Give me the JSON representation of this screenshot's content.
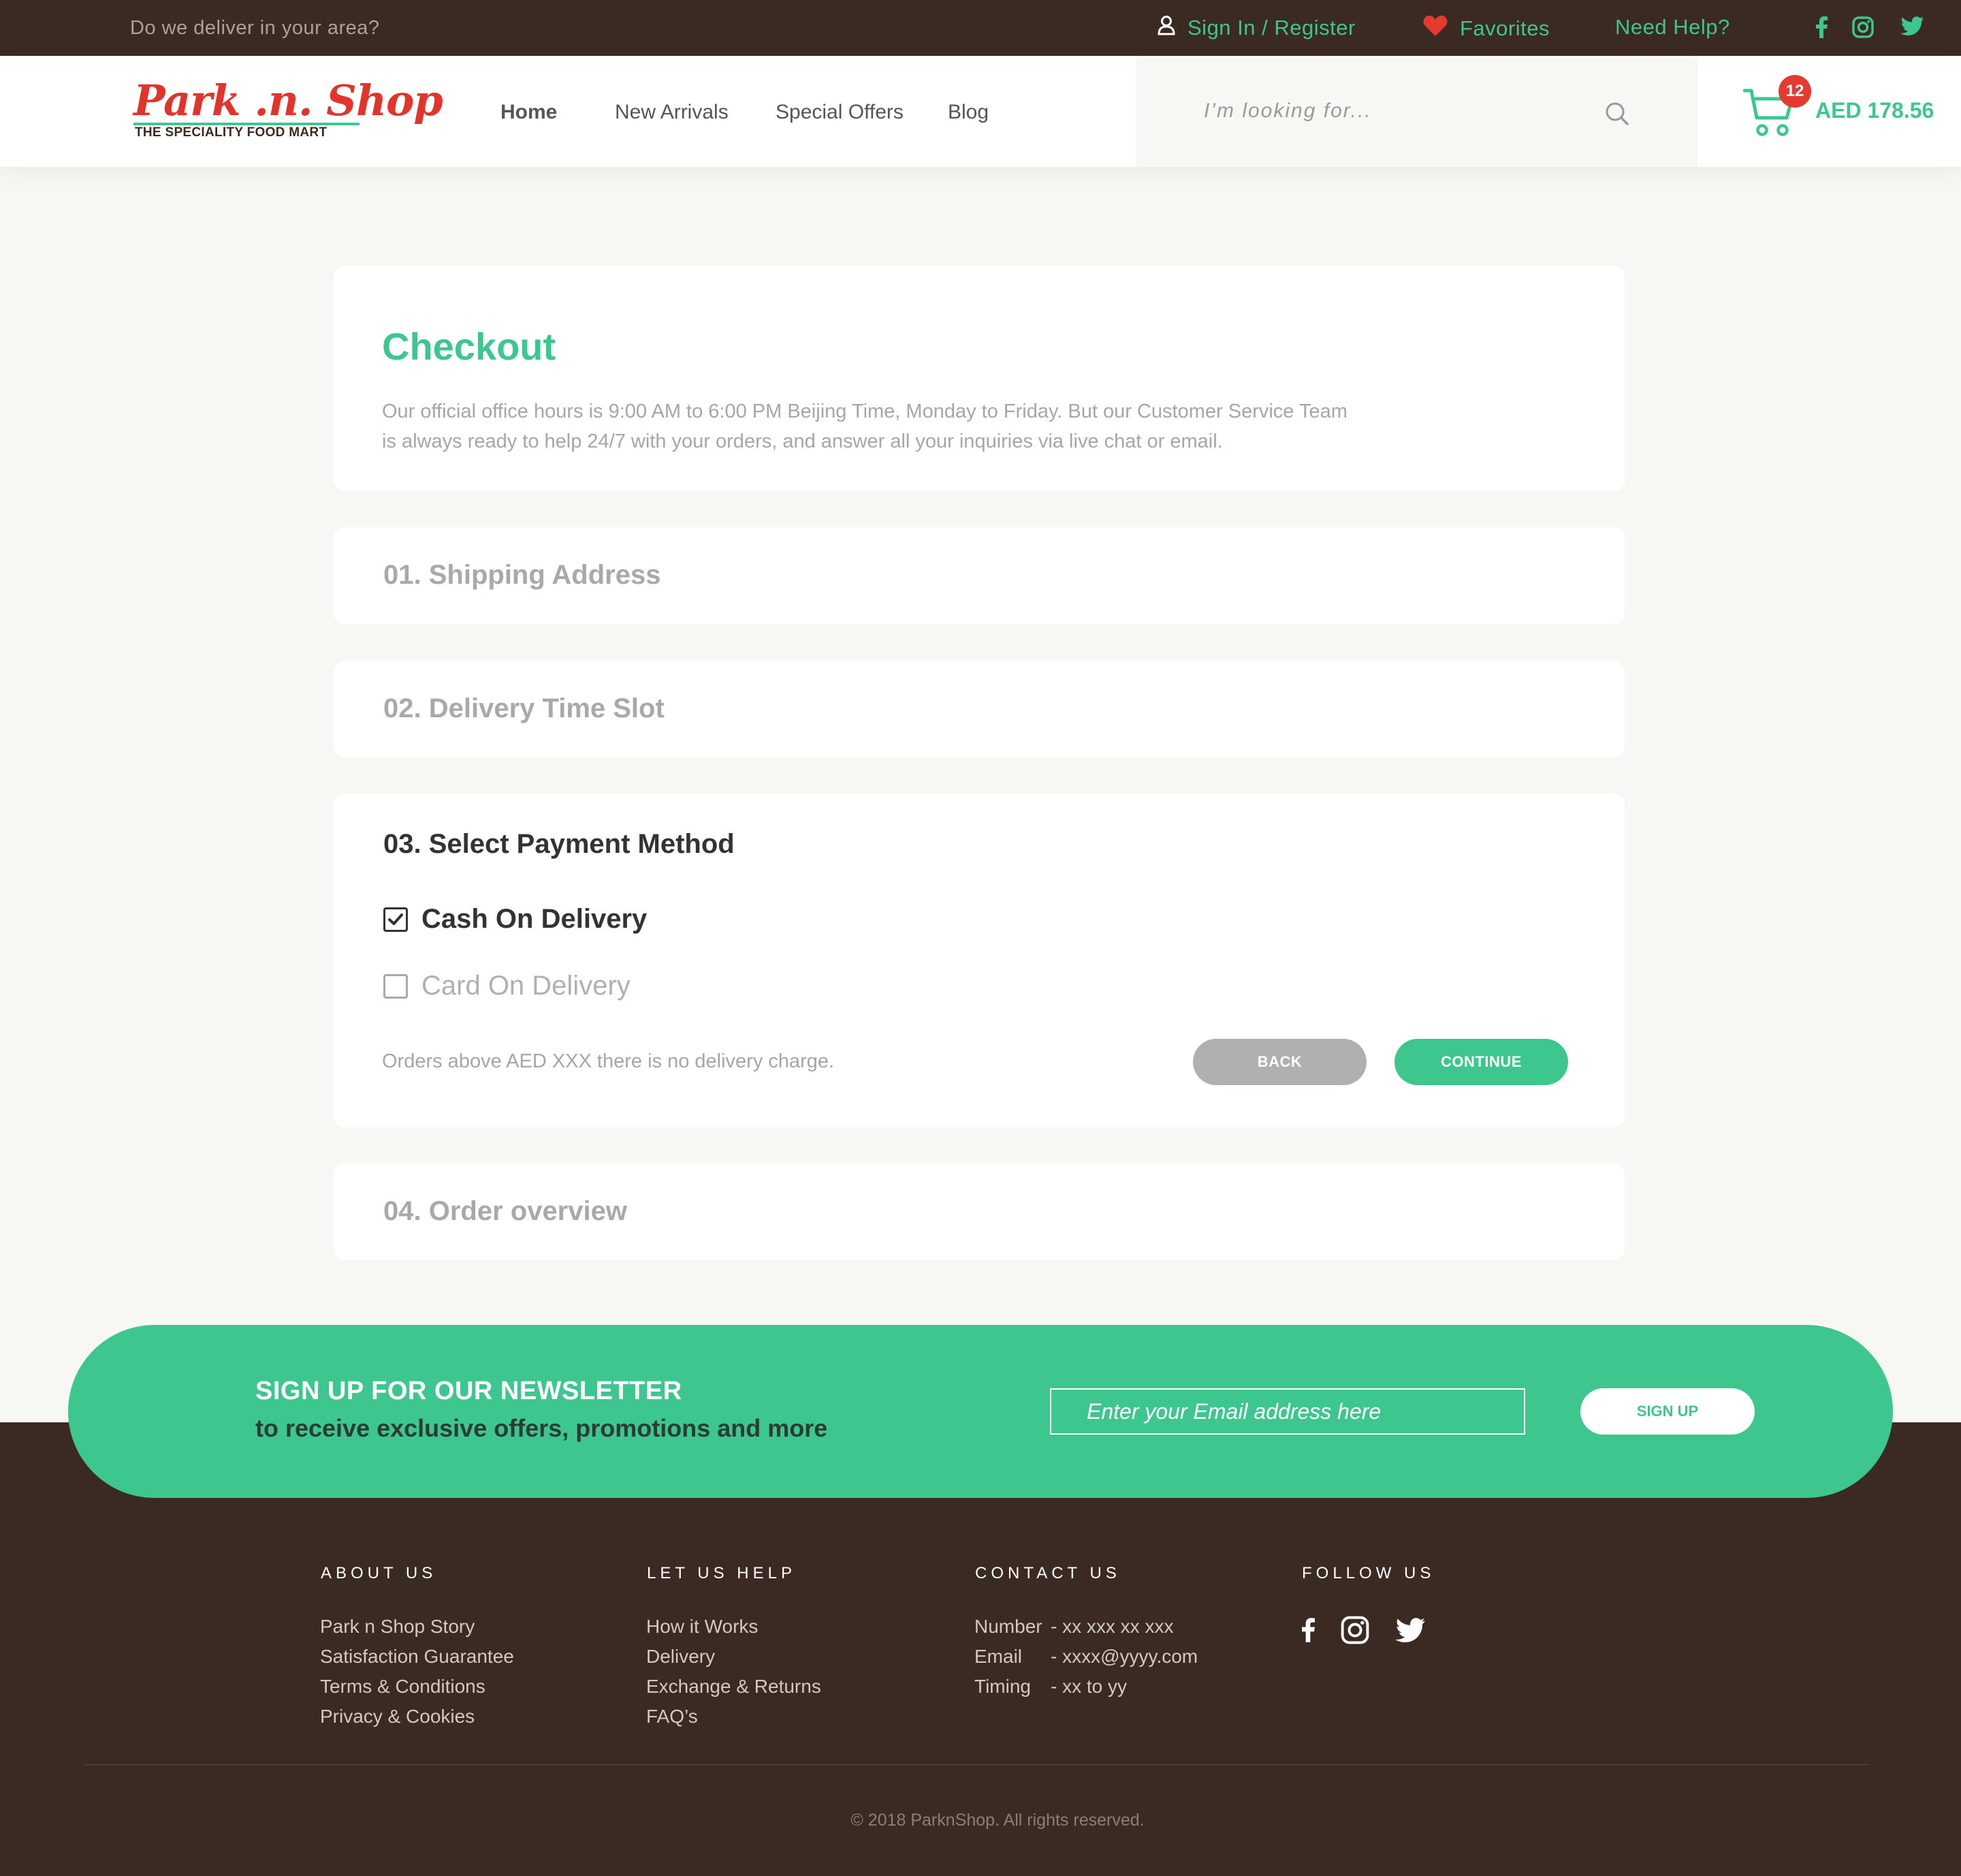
{
  "topbar": {
    "deliver_text": "Do we deliver in your area?",
    "signin_label": "Sign In / Register",
    "favorites_label": "Favorites",
    "help_label": "Need Help?"
  },
  "header": {
    "logo_script": "Park .n. Shop",
    "logo_tagline": "THE SPECIALITY FOOD MART",
    "nav": [
      "Home",
      "New Arrivals",
      "Special Offers",
      "Blog"
    ],
    "search_placeholder": "I’m looking for...",
    "cart_count": "12",
    "cart_total": "AED 178.56"
  },
  "checkout": {
    "title": "Checkout",
    "description": "Our official office hours is 9:00 AM to 6:00 PM Beijing Time, Monday to Friday. But our Customer Service Team is always ready to help 24/7 with your orders, and answer all your inquiries via live chat or email.",
    "steps": {
      "shipping": "01. Shipping Address",
      "delivery": "02. Delivery Time Slot",
      "payment": "03. Select Payment Method",
      "overview": "04. Order overview"
    },
    "payment_options": [
      {
        "label": "Cash On Delivery",
        "checked": true
      },
      {
        "label": "Card On Delivery",
        "checked": false
      }
    ],
    "delivery_note": "Orders above AED XXX there is no delivery charge.",
    "back_label": "BACK",
    "continue_label": "CONTINUE"
  },
  "newsletter": {
    "title": "SIGN UP FOR OUR NEWSLETTER",
    "subtitle": "to receive exclusive offers, promotions and more",
    "email_placeholder": "Enter your Email address here",
    "signup_label": "SIGN UP"
  },
  "footer": {
    "about": {
      "heading": "ABOUT US",
      "links": [
        "Park n Shop Story",
        "Satisfaction Guarantee",
        "Terms & Conditions",
        "Privacy & Cookies"
      ]
    },
    "help": {
      "heading": "LET US HELP",
      "links": [
        "How it Works",
        "Delivery",
        "Exchange & Returns",
        "FAQ’s"
      ]
    },
    "contact": {
      "heading": "CONTACT US",
      "rows": [
        {
          "key": "Number",
          "value": "- xx xxx xx xxx"
        },
        {
          "key": "Email",
          "value": "- xxxx@yyyy.com"
        },
        {
          "key": "Timing",
          "value": "- xx to yy"
        }
      ]
    },
    "follow": {
      "heading": "FOLLOW US"
    },
    "copyright": "© 2018 ParknShop. All rights reserved."
  },
  "colors": {
    "brand_green": "#3ec68f",
    "dark_brown": "#3b2a22",
    "accent_red": "#e53a2f",
    "page_bg": "#f7f7f3"
  },
  "icons": [
    "user-icon",
    "heart-icon",
    "facebook-icon",
    "instagram-icon",
    "twitter-icon",
    "search-icon",
    "cart-icon",
    "checkbox-checked-icon",
    "checkbox-empty-icon"
  ]
}
